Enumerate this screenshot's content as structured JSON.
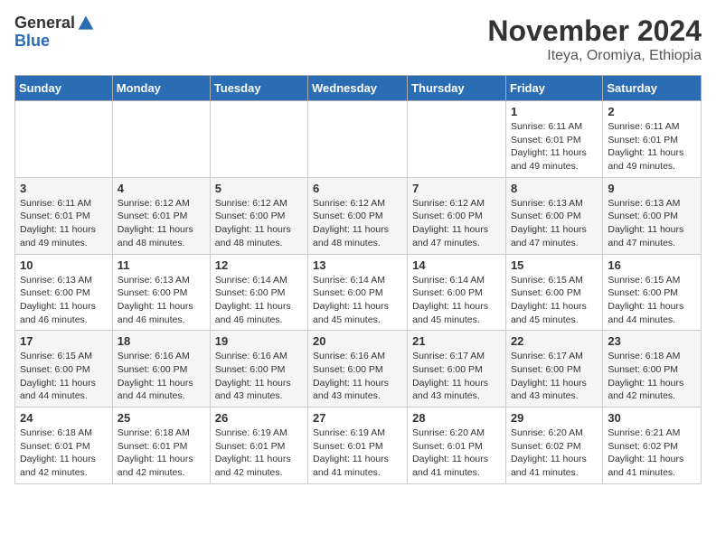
{
  "header": {
    "logo_general": "General",
    "logo_blue": "Blue",
    "title": "November 2024",
    "subtitle": "Iteya, Oromiya, Ethiopia"
  },
  "calendar": {
    "days_of_week": [
      "Sunday",
      "Monday",
      "Tuesday",
      "Wednesday",
      "Thursday",
      "Friday",
      "Saturday"
    ],
    "weeks": [
      [
        {
          "day": "",
          "info": ""
        },
        {
          "day": "",
          "info": ""
        },
        {
          "day": "",
          "info": ""
        },
        {
          "day": "",
          "info": ""
        },
        {
          "day": "",
          "info": ""
        },
        {
          "day": "1",
          "info": "Sunrise: 6:11 AM\nSunset: 6:01 PM\nDaylight: 11 hours\nand 49 minutes."
        },
        {
          "day": "2",
          "info": "Sunrise: 6:11 AM\nSunset: 6:01 PM\nDaylight: 11 hours\nand 49 minutes."
        }
      ],
      [
        {
          "day": "3",
          "info": "Sunrise: 6:11 AM\nSunset: 6:01 PM\nDaylight: 11 hours\nand 49 minutes."
        },
        {
          "day": "4",
          "info": "Sunrise: 6:12 AM\nSunset: 6:01 PM\nDaylight: 11 hours\nand 48 minutes."
        },
        {
          "day": "5",
          "info": "Sunrise: 6:12 AM\nSunset: 6:00 PM\nDaylight: 11 hours\nand 48 minutes."
        },
        {
          "day": "6",
          "info": "Sunrise: 6:12 AM\nSunset: 6:00 PM\nDaylight: 11 hours\nand 48 minutes."
        },
        {
          "day": "7",
          "info": "Sunrise: 6:12 AM\nSunset: 6:00 PM\nDaylight: 11 hours\nand 47 minutes."
        },
        {
          "day": "8",
          "info": "Sunrise: 6:13 AM\nSunset: 6:00 PM\nDaylight: 11 hours\nand 47 minutes."
        },
        {
          "day": "9",
          "info": "Sunrise: 6:13 AM\nSunset: 6:00 PM\nDaylight: 11 hours\nand 47 minutes."
        }
      ],
      [
        {
          "day": "10",
          "info": "Sunrise: 6:13 AM\nSunset: 6:00 PM\nDaylight: 11 hours\nand 46 minutes."
        },
        {
          "day": "11",
          "info": "Sunrise: 6:13 AM\nSunset: 6:00 PM\nDaylight: 11 hours\nand 46 minutes."
        },
        {
          "day": "12",
          "info": "Sunrise: 6:14 AM\nSunset: 6:00 PM\nDaylight: 11 hours\nand 46 minutes."
        },
        {
          "day": "13",
          "info": "Sunrise: 6:14 AM\nSunset: 6:00 PM\nDaylight: 11 hours\nand 45 minutes."
        },
        {
          "day": "14",
          "info": "Sunrise: 6:14 AM\nSunset: 6:00 PM\nDaylight: 11 hours\nand 45 minutes."
        },
        {
          "day": "15",
          "info": "Sunrise: 6:15 AM\nSunset: 6:00 PM\nDaylight: 11 hours\nand 45 minutes."
        },
        {
          "day": "16",
          "info": "Sunrise: 6:15 AM\nSunset: 6:00 PM\nDaylight: 11 hours\nand 44 minutes."
        }
      ],
      [
        {
          "day": "17",
          "info": "Sunrise: 6:15 AM\nSunset: 6:00 PM\nDaylight: 11 hours\nand 44 minutes."
        },
        {
          "day": "18",
          "info": "Sunrise: 6:16 AM\nSunset: 6:00 PM\nDaylight: 11 hours\nand 44 minutes."
        },
        {
          "day": "19",
          "info": "Sunrise: 6:16 AM\nSunset: 6:00 PM\nDaylight: 11 hours\nand 43 minutes."
        },
        {
          "day": "20",
          "info": "Sunrise: 6:16 AM\nSunset: 6:00 PM\nDaylight: 11 hours\nand 43 minutes."
        },
        {
          "day": "21",
          "info": "Sunrise: 6:17 AM\nSunset: 6:00 PM\nDaylight: 11 hours\nand 43 minutes."
        },
        {
          "day": "22",
          "info": "Sunrise: 6:17 AM\nSunset: 6:00 PM\nDaylight: 11 hours\nand 43 minutes."
        },
        {
          "day": "23",
          "info": "Sunrise: 6:18 AM\nSunset: 6:00 PM\nDaylight: 11 hours\nand 42 minutes."
        }
      ],
      [
        {
          "day": "24",
          "info": "Sunrise: 6:18 AM\nSunset: 6:01 PM\nDaylight: 11 hours\nand 42 minutes."
        },
        {
          "day": "25",
          "info": "Sunrise: 6:18 AM\nSunset: 6:01 PM\nDaylight: 11 hours\nand 42 minutes."
        },
        {
          "day": "26",
          "info": "Sunrise: 6:19 AM\nSunset: 6:01 PM\nDaylight: 11 hours\nand 42 minutes."
        },
        {
          "day": "27",
          "info": "Sunrise: 6:19 AM\nSunset: 6:01 PM\nDaylight: 11 hours\nand 41 minutes."
        },
        {
          "day": "28",
          "info": "Sunrise: 6:20 AM\nSunset: 6:01 PM\nDaylight: 11 hours\nand 41 minutes."
        },
        {
          "day": "29",
          "info": "Sunrise: 6:20 AM\nSunset: 6:02 PM\nDaylight: 11 hours\nand 41 minutes."
        },
        {
          "day": "30",
          "info": "Sunrise: 6:21 AM\nSunset: 6:02 PM\nDaylight: 11 hours\nand 41 minutes."
        }
      ]
    ]
  }
}
